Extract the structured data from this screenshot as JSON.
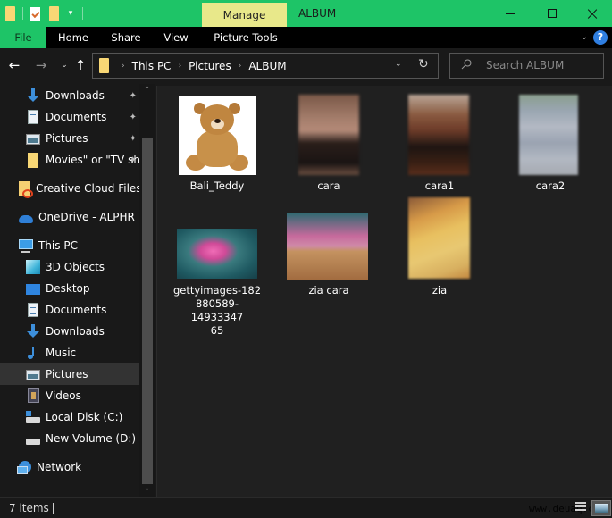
{
  "window": {
    "title": "ALBUM",
    "contextual_tab": "Manage",
    "controls": {
      "minimize": "minimize",
      "maximize": "maximize",
      "close": "×"
    }
  },
  "quick_access_toolbar": {
    "items": [
      "folder-icon",
      "properties-icon",
      "new-folder-icon",
      "customize-dropdown-icon"
    ]
  },
  "ribbon": {
    "tabs": [
      {
        "label": "File",
        "active": true
      },
      {
        "label": "Home"
      },
      {
        "label": "Share"
      },
      {
        "label": "View"
      },
      {
        "label": "Picture Tools"
      }
    ],
    "collapse_glyph": "⌄",
    "help_glyph": "?"
  },
  "navigation": {
    "back_glyph": "←",
    "forward_glyph": "→",
    "recent_glyph": "⌄",
    "up_glyph": "↑",
    "breadcrumbs": [
      "This PC",
      "Pictures",
      "ALBUM"
    ],
    "breadcrumb_sep": "›",
    "dropdown_glyph": "⌄",
    "refresh_glyph": "↻",
    "search_placeholder": "Search ALBUM"
  },
  "sidebar": {
    "items": [
      {
        "label": "Downloads",
        "icon": "downloads",
        "pinned": true
      },
      {
        "label": "Documents",
        "icon": "documents",
        "pinned": true
      },
      {
        "label": "Pictures",
        "icon": "pictures",
        "pinned": true
      },
      {
        "label": "Movies\" or \"TV sh",
        "icon": "folder",
        "pinned": true
      },
      {
        "label": "Creative Cloud Files",
        "icon": "creative-cloud"
      },
      {
        "label": "OneDrive - ALPHR",
        "icon": "onedrive"
      },
      {
        "label": "This PC",
        "icon": "this-pc"
      },
      {
        "label": "3D Objects",
        "icon": "3d-objects"
      },
      {
        "label": "Desktop",
        "icon": "desktop"
      },
      {
        "label": "Documents",
        "icon": "documents"
      },
      {
        "label": "Downloads",
        "icon": "downloads"
      },
      {
        "label": "Music",
        "icon": "music"
      },
      {
        "label": "Pictures",
        "icon": "pictures",
        "selected": true
      },
      {
        "label": "Videos",
        "icon": "videos"
      },
      {
        "label": "Local Disk (C:)",
        "icon": "local-disk"
      },
      {
        "label": "New Volume (D:)",
        "icon": "drive"
      },
      {
        "label": "Network",
        "icon": "network"
      }
    ],
    "pin_glyph": "📌"
  },
  "files": [
    {
      "name": "Bali_Teddy",
      "type": "image"
    },
    {
      "name": "cara",
      "type": "image"
    },
    {
      "name": "cara1",
      "type": "image"
    },
    {
      "name": "cara2",
      "type": "image"
    },
    {
      "name": "gettyimages-182880589-1493334765",
      "label_lines": [
        "gettyimages-182",
        "880589-14933347",
        "65"
      ],
      "type": "image"
    },
    {
      "name": "zia cara",
      "type": "image"
    },
    {
      "name": "zia",
      "type": "image"
    }
  ],
  "status": {
    "item_count": "7 items",
    "watermark": "www.deuaq.com"
  }
}
